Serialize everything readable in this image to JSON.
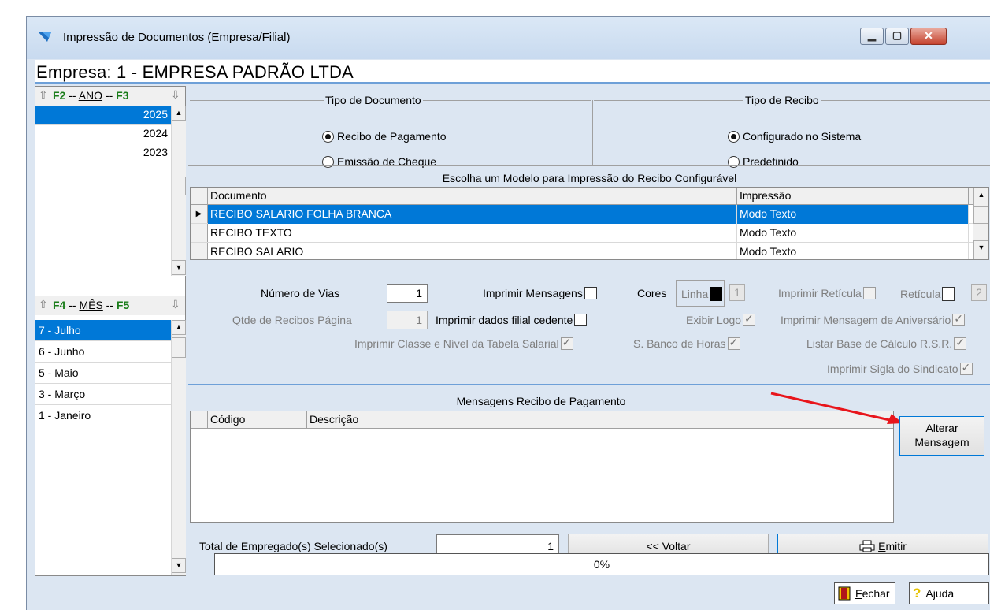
{
  "window": {
    "title": "Impressão de Documentos (Empresa/Filial)",
    "min_glyph": "▁",
    "max_glyph": "▢",
    "close_glyph": "✕"
  },
  "empresa": "Empresa: 1 - EMPRESA PADRÃO LTDA",
  "ano_nav": {
    "prev": "F2",
    "sep1": " -- ",
    "label": "ANO",
    "sep2": " -- ",
    "next": "F3",
    "years": [
      "2025",
      "2024",
      "2023"
    ],
    "selected_index": 0
  },
  "mes_nav": {
    "prev": "F4",
    "sep1": " -- ",
    "label": "MÊS",
    "sep2": " -- ",
    "next": "F5",
    "months": [
      "7 - Julho",
      "6 - Junho",
      "5 - Maio",
      "3 - Março",
      "1 - Janeiro"
    ],
    "selected_index": 0
  },
  "tipo_documento": {
    "title": "Tipo de Documento",
    "options": [
      "Recibo de Pagamento",
      "Emissão de Cheque"
    ],
    "selected_index": 0
  },
  "tipo_recibo": {
    "title": "Tipo de Recibo",
    "options": [
      "Configurado no Sistema",
      "Predefinido"
    ],
    "selected_index": 0
  },
  "modelo": {
    "title": "Escolha um Modelo para Impressão do Recibo Configurável",
    "columns": [
      "Documento",
      "Impressão"
    ],
    "rows": [
      [
        "RECIBO SALARIO FOLHA BRANCA",
        "Modo Texto"
      ],
      [
        "RECIBO TEXTO",
        "Modo Texto"
      ],
      [
        "RECIBO SALARIO",
        "Modo Texto"
      ]
    ],
    "selected_index": 0
  },
  "opcoes": {
    "numero_vias_label": "Número de Vias",
    "numero_vias_value": "1",
    "qtde_recibos_label": "Qtde de Recibos Página",
    "qtde_recibos_value": "1",
    "imprimir_mensagens": "Imprimir Mensagens",
    "imprimir_dados_filial": "Imprimir dados filial cedente",
    "imprimir_classe": "Imprimir Classe e Nível da Tabela Salarial",
    "banco_horas": "S. Banco de Horas",
    "cores": "Cores",
    "linha": "Linha",
    "linha_value": "1",
    "imprimir_reticula": "Imprimir Retícula",
    "reticula": "Retícula",
    "reticula_value": "2",
    "exibir_logo": "Exibir Logo",
    "mensagem_aniversario": "Imprimir Mensagem de Aniversário",
    "base_calculo": "Listar Base de Cálculo R.S.R.",
    "sigla_sindicato": "Imprimir Sigla do Sindicato"
  },
  "mensagens": {
    "title": "Mensagens Recibo de Pagamento",
    "columns": [
      "Código",
      "Descrição"
    ],
    "alterar_line1": "Alterar",
    "alterar_line2": "Mensagem"
  },
  "footer": {
    "total_label": "Total de Empregado(s) Selecionado(s)",
    "total_value": "1",
    "voltar": "<< Voltar",
    "emitir_rest": "mitir",
    "emitir_key": "E",
    "progress_text": "0%",
    "progress_value": 0,
    "fechar_key": "F",
    "fechar_rest": "echar",
    "ajuda": "Ajuda"
  }
}
